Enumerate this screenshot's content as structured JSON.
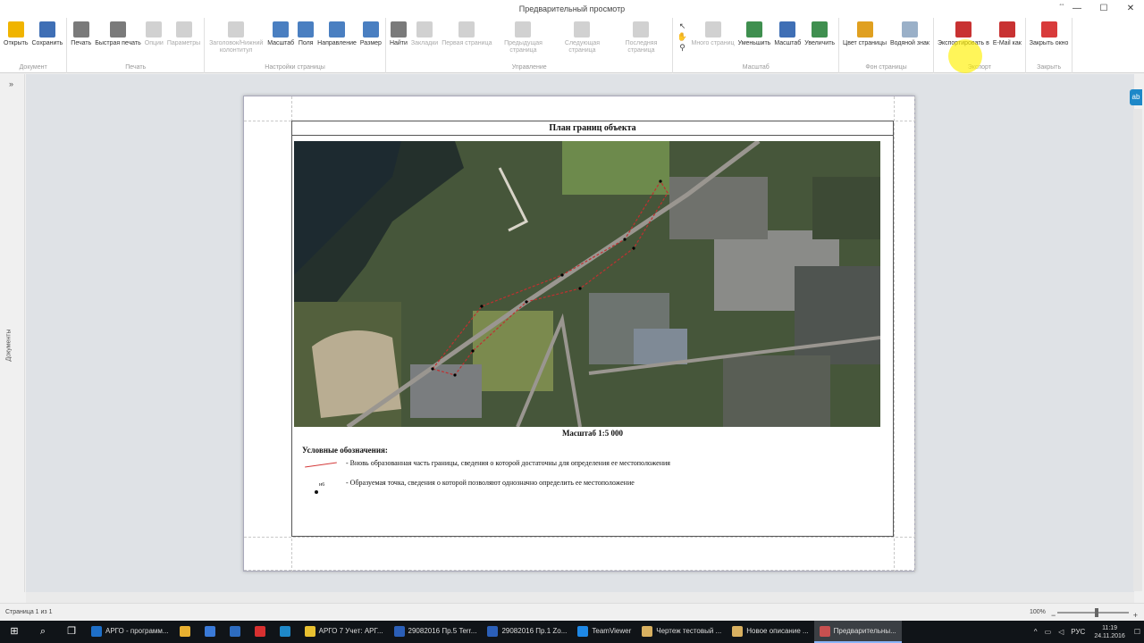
{
  "window": {
    "title": "Предварительный просмотр"
  },
  "ribbon": {
    "groups": [
      {
        "id": "document",
        "label": "Документ",
        "buttons": [
          {
            "label": "Открыть",
            "icon": "folder-open-icon",
            "color": "#f0b400"
          },
          {
            "label": "Сохранить",
            "icon": "floppy-disk-icon",
            "color": "#3f6fb5"
          }
        ]
      },
      {
        "id": "print",
        "label": "Печать",
        "buttons": [
          {
            "label": "Печать",
            "icon": "printer-icon",
            "color": "#7a7a7a"
          },
          {
            "label": "Быстрая печать",
            "icon": "quick-print-icon",
            "color": "#7a7a7a"
          },
          {
            "label": "Опции",
            "icon": "options-icon",
            "color": "#9a9a9a",
            "disabled": true
          },
          {
            "label": "Параметры",
            "icon": "parameters-icon",
            "color": "#9a9a9a",
            "disabled": true
          }
        ]
      },
      {
        "id": "pagesetup",
        "label": "Настройки страницы",
        "buttons": [
          {
            "label": "Заголовок/Нижний колонтитул",
            "icon": "header-footer-icon",
            "color": "#9a9a9a",
            "disabled": true
          },
          {
            "label": "Масштаб",
            "icon": "scale-page-icon",
            "color": "#4a7fc1"
          },
          {
            "label": "Поля",
            "icon": "margins-icon",
            "color": "#4a7fc1"
          },
          {
            "label": "Направление",
            "icon": "orientation-icon",
            "color": "#4a7fc1"
          },
          {
            "label": "Размер",
            "icon": "page-size-icon",
            "color": "#4a7fc1"
          }
        ]
      },
      {
        "id": "navigation",
        "label": "Управление",
        "buttons": [
          {
            "label": "Найти",
            "icon": "binoculars-icon",
            "color": "#7a7a7a"
          },
          {
            "label": "Закладки",
            "icon": "bookmarks-icon",
            "color": "#9a9a9a",
            "disabled": true
          },
          {
            "label": "Первая страница",
            "icon": "first-page-icon",
            "color": "#9a9a9a",
            "disabled": true
          },
          {
            "label": "Предыдущая страница",
            "icon": "prev-page-icon",
            "color": "#9a9a9a",
            "disabled": true
          },
          {
            "label": "Следующая страница",
            "icon": "next-page-icon",
            "color": "#9a9a9a",
            "disabled": true
          },
          {
            "label": "Последняя страница",
            "icon": "last-page-icon",
            "color": "#9a9a9a",
            "disabled": true
          }
        ]
      },
      {
        "id": "zoom",
        "label": "Масштаб",
        "buttons": [
          {
            "label": "Много страниц",
            "icon": "multi-page-icon",
            "color": "#9a9a9a",
            "disabled": true
          },
          {
            "label": "Уменьшить",
            "icon": "zoom-out-icon",
            "color": "#3f8f4f"
          },
          {
            "label": "Масштаб",
            "icon": "zoom-icon",
            "color": "#3f6fb5"
          },
          {
            "label": "Увеличить",
            "icon": "zoom-in-icon",
            "color": "#3f8f4f"
          }
        ]
      },
      {
        "id": "background",
        "label": "Фон страницы",
        "buttons": [
          {
            "label": "Цвет страницы",
            "icon": "paint-bucket-icon",
            "color": "#e0a020"
          },
          {
            "label": "Водяной знак",
            "icon": "watermark-icon",
            "color": "#9ab0c8"
          }
        ]
      },
      {
        "id": "export",
        "label": "Экспорт",
        "buttons": [
          {
            "label": "Экспортировать в",
            "icon": "export-pdf-icon",
            "color": "#c83232"
          },
          {
            "label": "E-Mail как",
            "icon": "email-pdf-icon",
            "color": "#c83232"
          }
        ]
      },
      {
        "id": "close",
        "label": "Закрыть",
        "buttons": [
          {
            "label": "Закрыть окно",
            "icon": "close-window-icon",
            "color": "#d83b3b"
          }
        ]
      }
    ]
  },
  "sidepanel": {
    "label": "Документы"
  },
  "document": {
    "title": "План границ объекта",
    "scale": "Масштаб 1:5 000",
    "legend_title": "Условные обозначения:",
    "legend_line_text": "- Вновь образованная часть границы, сведения о которой достаточны для определения ее местоположения",
    "legend_point_label": "н6",
    "legend_point_text": "- Образуемая точка, сведения о которой позволяют однозначно определить ее местоположение"
  },
  "status": {
    "page": "Страница 1 из 1",
    "zoom": "100%"
  },
  "taskbar": {
    "apps": [
      {
        "label": "АРГО - программ...",
        "color": "#1e6fc8"
      },
      {
        "label": "",
        "color": "#e8b030"
      },
      {
        "label": "",
        "color": "#3a7ad8"
      },
      {
        "label": "",
        "color": "#2d6cc0"
      },
      {
        "label": "",
        "color": "#d83030"
      },
      {
        "label": "",
        "color": "#1e88c8"
      },
      {
        "label": "АРГО 7 Учет: АРГ...",
        "color": "#e8c030"
      },
      {
        "label": "29082016 Пр.5 Terr...",
        "color": "#2b5fb8"
      },
      {
        "label": "29082016 Пр.1 Zo...",
        "color": "#2b5fb8"
      },
      {
        "label": "TeamViewer",
        "color": "#1e88e5"
      },
      {
        "label": "Чертеж тестовый ...",
        "color": "#d8b060"
      },
      {
        "label": "Новое описание ...",
        "color": "#d8b060"
      },
      {
        "label": "Предварительны...",
        "color": "#c85050",
        "active": true
      }
    ],
    "lang": "РУС",
    "time": "11:19",
    "date": "24.11.2016"
  }
}
